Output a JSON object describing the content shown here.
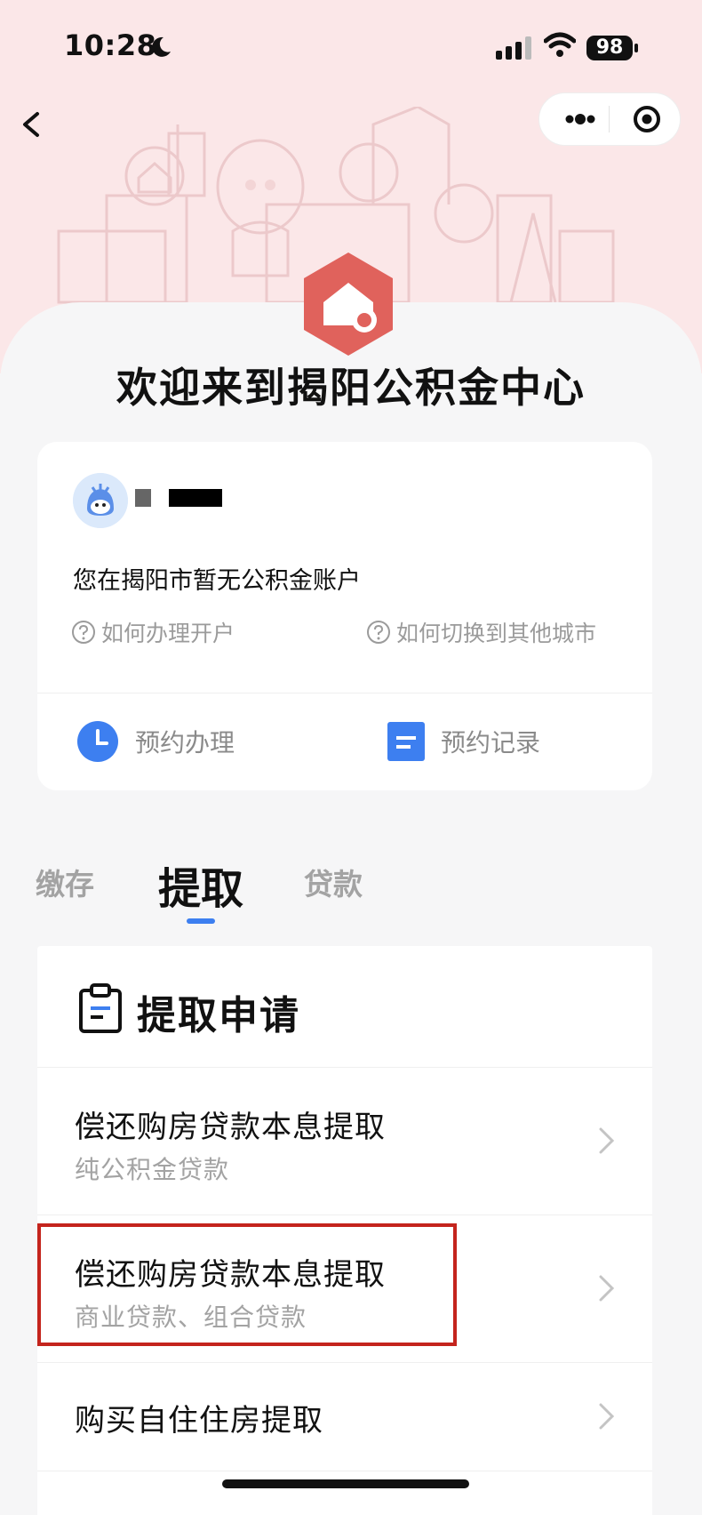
{
  "status_bar": {
    "time": "10:28",
    "battery": "98"
  },
  "welcome": "欢迎来到揭阳公积金中心",
  "account_card": {
    "no_account_text": "您在揭阳市暂无公积金账户",
    "help_open": "如何办理开户",
    "help_switch": "如何切换到其他城市",
    "appointment": "预约办理",
    "appointment_records": "预约记录"
  },
  "tabs": [
    {
      "label": "缴存",
      "active": false
    },
    {
      "label": "提取",
      "active": true
    },
    {
      "label": "贷款",
      "active": false
    }
  ],
  "panel": {
    "title": "提取申请",
    "items": [
      {
        "title": "偿还购房贷款本息提取",
        "subtitle": "纯公积金贷款"
      },
      {
        "title": "偿还购房贷款本息提取",
        "subtitle": "商业贷款、组合贷款"
      },
      {
        "title": "购买自住住房提取",
        "subtitle": ""
      }
    ]
  },
  "colors": {
    "accent": "#3d7ff0",
    "logo": "#e0625c",
    "highlight": "#c4241d",
    "hero": "#fbe7e8"
  }
}
